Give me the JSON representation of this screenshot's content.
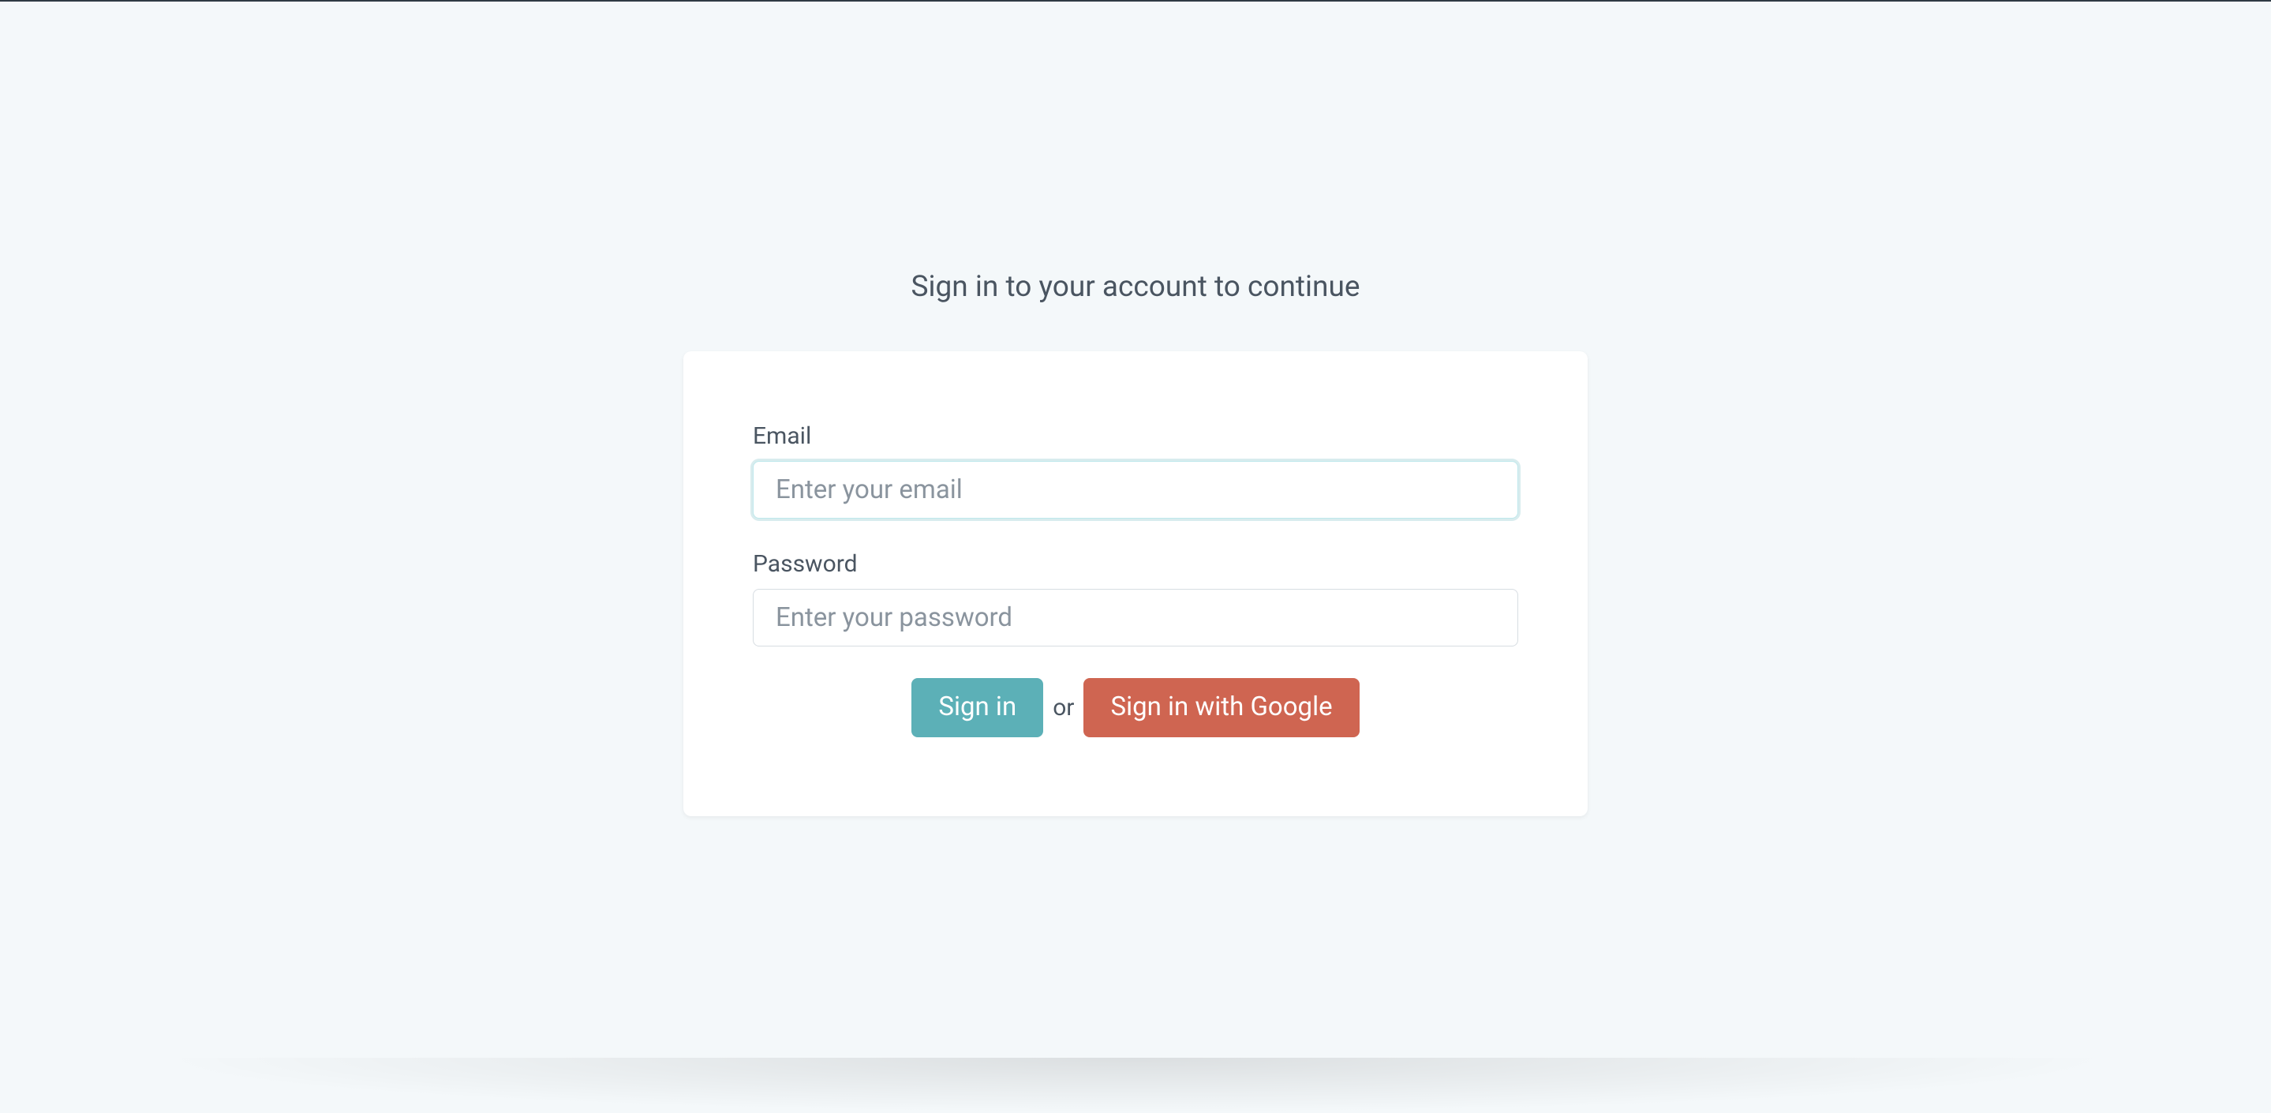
{
  "heading": "Sign in to your account to continue",
  "form": {
    "email": {
      "label": "Email",
      "placeholder": "Enter your email",
      "value": ""
    },
    "password": {
      "label": "Password",
      "placeholder": "Enter your password",
      "value": ""
    }
  },
  "buttons": {
    "signin": "Sign in",
    "or": "or",
    "google": "Sign in with Google"
  }
}
